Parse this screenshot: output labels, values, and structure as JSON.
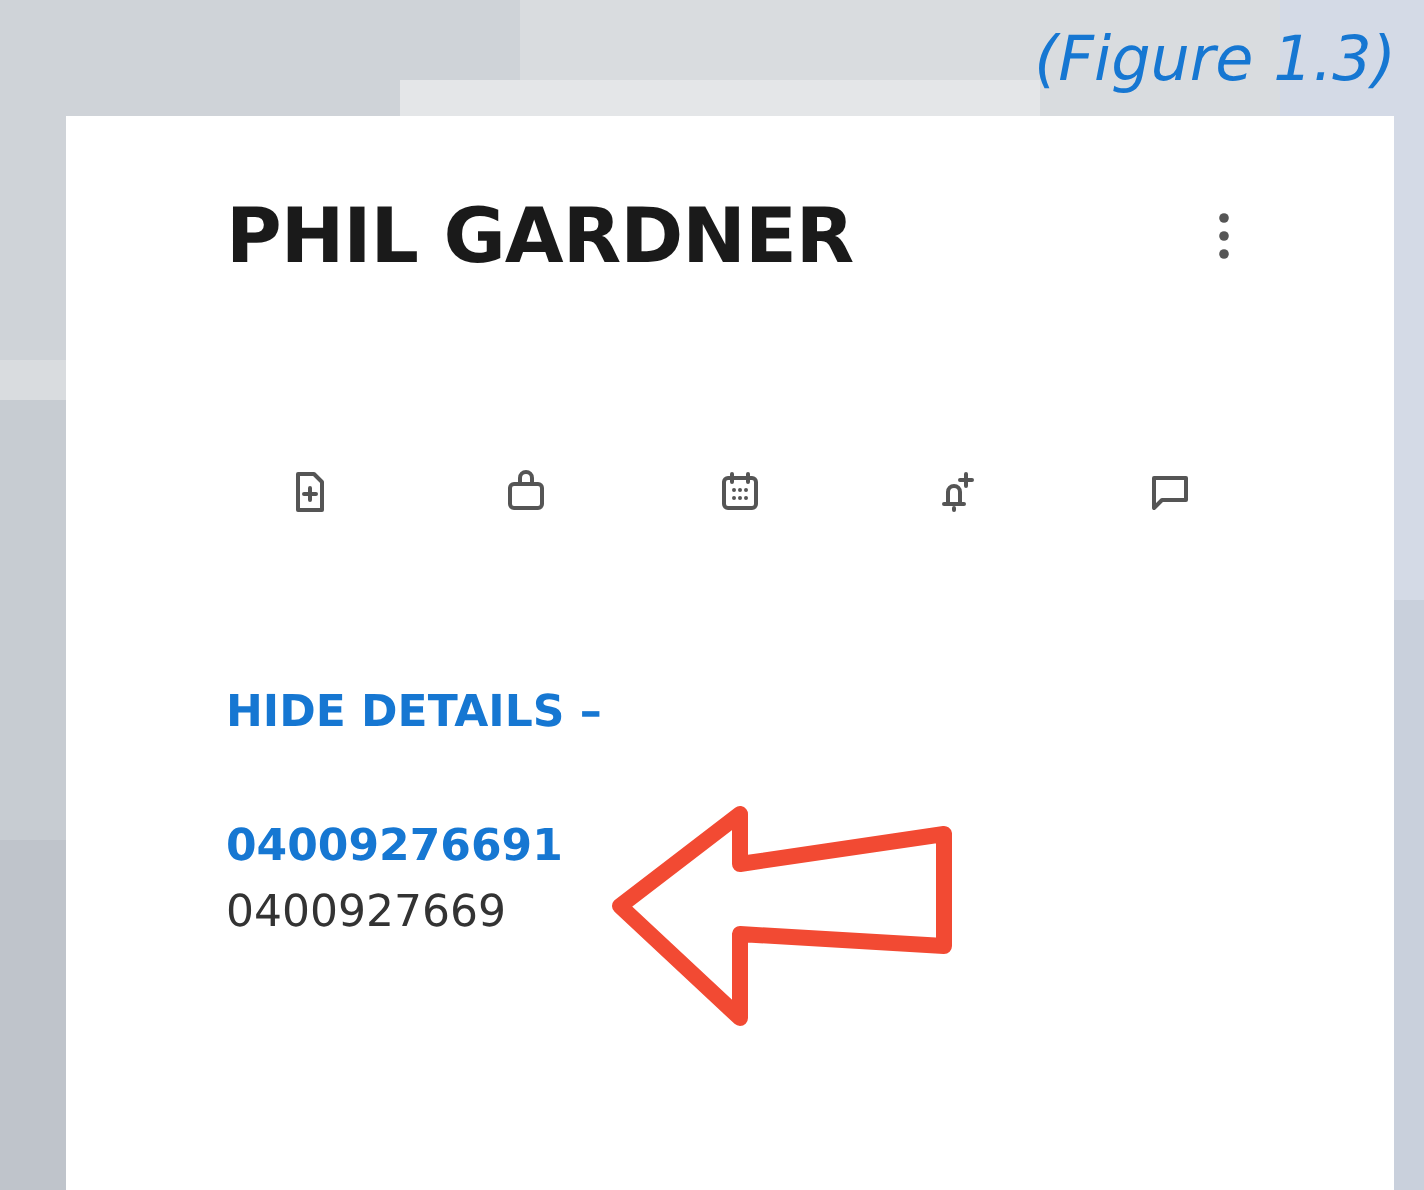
{
  "caption": "(Figure 1.3)",
  "contact": {
    "name": "PHIL GARDNER"
  },
  "details_toggle": "HIDE DETAILS –",
  "phones": [
    {
      "number": "04009276691",
      "kind": "link"
    },
    {
      "number": "0400927669",
      "kind": "text"
    }
  ]
}
